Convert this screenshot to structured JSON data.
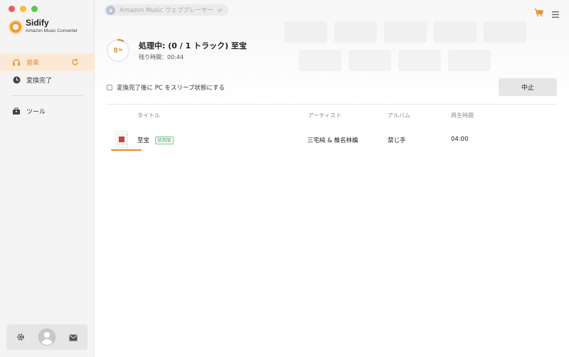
{
  "app": {
    "name": "Sidify",
    "subtitle": "Amazon Music Converter"
  },
  "sidebar": {
    "items": [
      {
        "label": "音楽",
        "icon": "headphones-icon",
        "active": true
      },
      {
        "label": "変換完了",
        "icon": "clock-icon",
        "active": false
      },
      {
        "label": "ツール",
        "icon": "toolbox-icon",
        "active": false
      }
    ],
    "bottom": {
      "icons": [
        "gear-icon",
        "avatar",
        "mail-icon"
      ]
    }
  },
  "topbar": {
    "source_badge": "a",
    "source_label": "Amazon Music ウェブプレーヤー",
    "swap_glyph": "⇄"
  },
  "status": {
    "percent": "8",
    "percent_sign": "%",
    "progress_fraction": 0.08,
    "title": "処理中: (0 / 1 トラック) 至宝",
    "remaining": "残り時間：00:44"
  },
  "options": {
    "sleep_label": "変換完了後に PC をスリープ状態にする",
    "sleep_checked": false
  },
  "actions": {
    "stop_label": "中止"
  },
  "table": {
    "headers": {
      "title": "タイトル",
      "artist": "アーティスト",
      "album": "アルバム",
      "duration": "再生時間"
    },
    "rows": [
      {
        "title": "至宝",
        "badge": "試用版",
        "artist": "三宅純 & 椎名林檎",
        "album": "禁じ手",
        "duration": "04:00"
      }
    ]
  },
  "colors": {
    "accent": "#e58a26",
    "active_bg": "#fbe9d6",
    "trial_green": "#4aa15a"
  }
}
